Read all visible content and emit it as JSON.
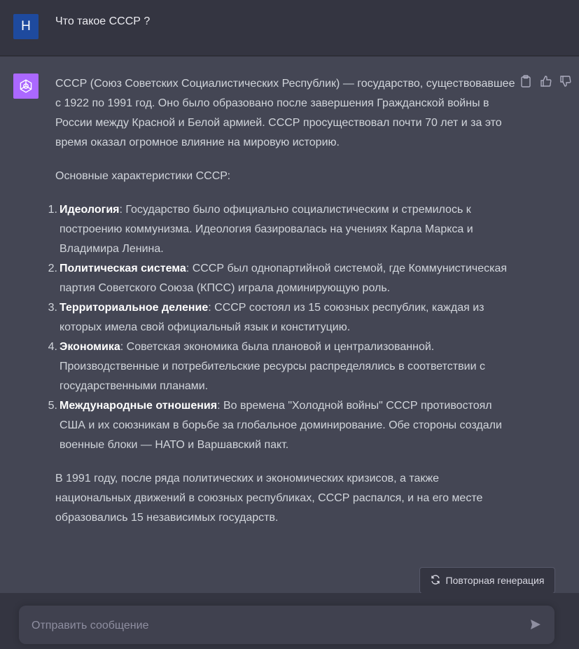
{
  "user": {
    "avatar_letter": "H",
    "message": "Что такое СССР ?"
  },
  "assistant": {
    "intro": "СССР (Союз Советских Социалистических Республик) — государство, существовавшее с 1922 по 1991 год. Оно было образовано после завершения Гражданской войны в России между Красной и Белой армией. СССР просуществовал почти 70 лет и за это время оказал огромное влияние на мировую историю.",
    "subheading": "Основные характеристики СССР:",
    "items": [
      {
        "num": "1.",
        "title": "Идеология",
        "text": ": Государство было официально социалистическим и стремилось к построению коммунизма. Идеология базировалась на учениях Карла Маркса и Владимира Ленина."
      },
      {
        "num": "2.",
        "title": "Политическая система",
        "text": ": СССР был однопартийной системой, где Коммунистическая партия Советского Союза (КПСС) играла доминирующую роль."
      },
      {
        "num": "3.",
        "title": "Территориальное деление",
        "text": ": СССР состоял из 15 союзных республик, каждая из которых имела свой официальный язык и конституцию."
      },
      {
        "num": "4.",
        "title": "Экономика",
        "text": ": Советская экономика была плановой и централизованной. Производственные и потребительские ресурсы распределялись в соответствии с государственными планами."
      },
      {
        "num": "5.",
        "title": "Международные отношения",
        "text": ": Во времена \"Холодной войны\" СССР противостоял США и их союзникам в борьбе за глобальное доминирование. Обе стороны создали военные блоки — НАТО и Варшавский пакт."
      }
    ],
    "conclusion": "В 1991 году, после ряда политических и экономических кризисов, а также национальных движений в союзных республиках, СССР распался, и на его месте образовались 15 независимых государств."
  },
  "regenerate_label": "Повторная генерация",
  "composer": {
    "placeholder": "Отправить сообщение"
  },
  "colors": {
    "background": "#343541",
    "assistant_bg": "#444654",
    "user_avatar": "#1e4a9e",
    "gpt_avatar": "#ab68ff"
  },
  "icons": {
    "copy": "clipboard-icon",
    "like": "thumbs-up-icon",
    "dislike": "thumbs-down-icon",
    "regenerate": "refresh-icon",
    "send": "send-icon"
  }
}
